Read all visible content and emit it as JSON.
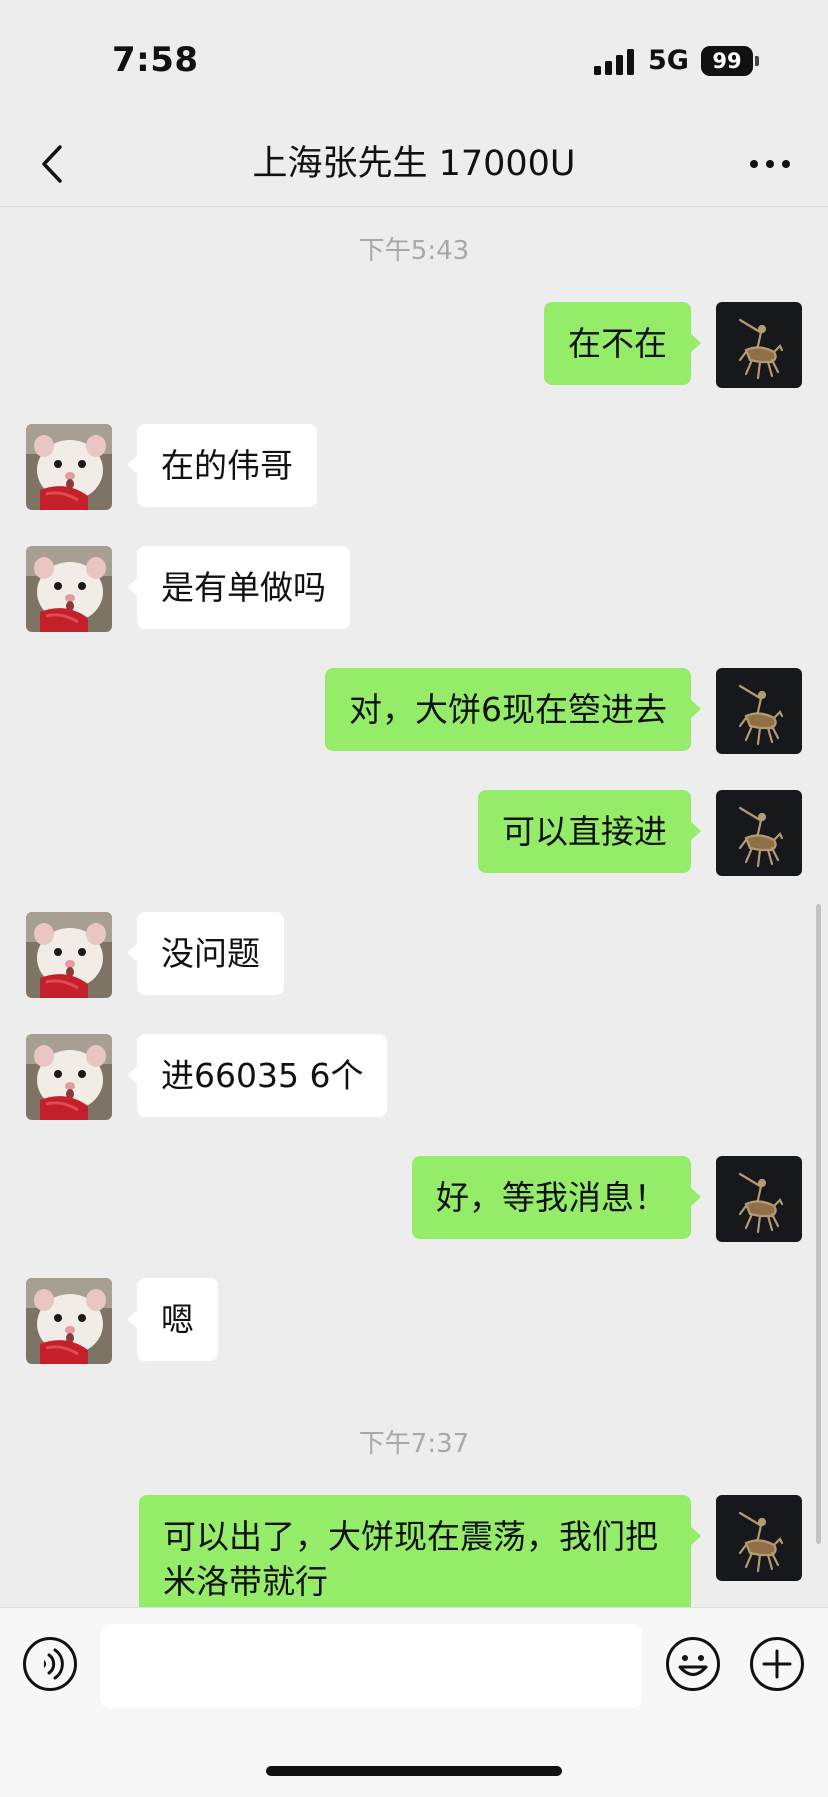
{
  "status": {
    "time": "7:58",
    "network": "5G",
    "battery": "99"
  },
  "nav": {
    "title": "上海张先生 17000U"
  },
  "timestamps": [
    "下午5:43",
    "下午7:37"
  ],
  "messages": [
    {
      "side": "out",
      "text": "在不在"
    },
    {
      "side": "in",
      "text": "在的伟哥"
    },
    {
      "side": "in",
      "text": "是有单做吗"
    },
    {
      "side": "out",
      "text": "对，大饼6现在箜进去"
    },
    {
      "side": "out",
      "text": "可以直接进"
    },
    {
      "side": "in",
      "text": "没问题"
    },
    {
      "side": "in",
      "text": "进66035 6个"
    },
    {
      "side": "out",
      "text": "好，等我消息！"
    },
    {
      "side": "in",
      "text": "嗯"
    },
    {
      "side": "out",
      "text": "可以出了，大饼现在震荡，我们把米洛带就行"
    }
  ],
  "input": {
    "value": ""
  },
  "icons": {
    "back": "chevron-left-icon",
    "more": "more-dots-icon",
    "voice": "voice-icon",
    "emoji": "emoji-icon",
    "plus": "plus-icon"
  },
  "colors": {
    "outgoing_bubble": "#95ec69",
    "incoming_bubble": "#ffffff",
    "background": "#ededed"
  }
}
